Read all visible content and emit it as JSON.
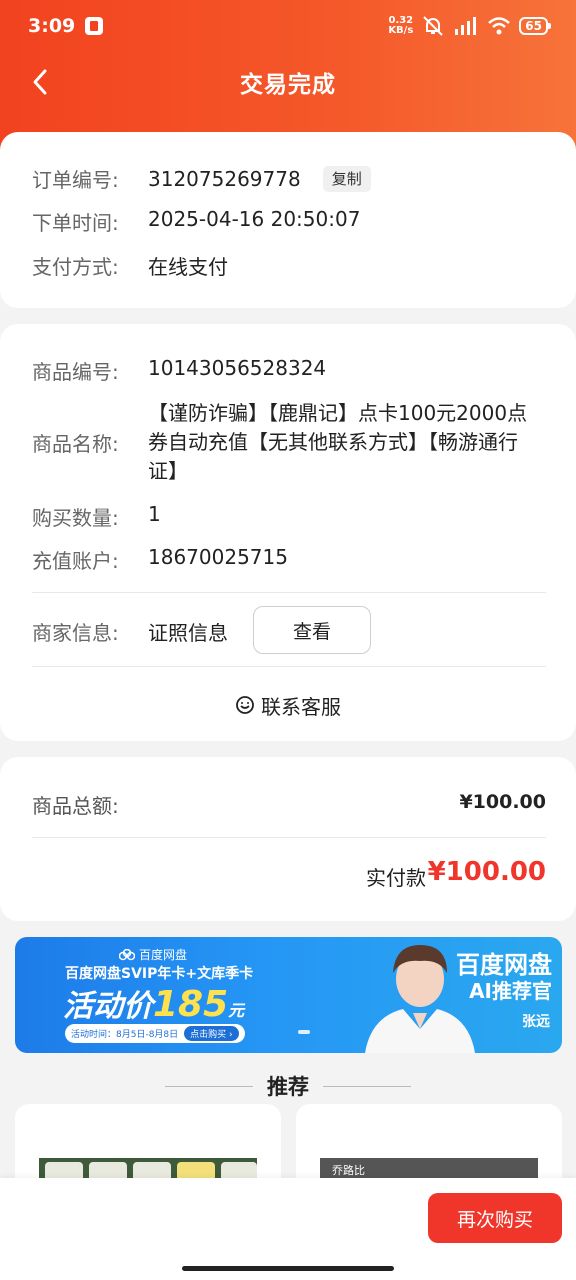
{
  "status_bar": {
    "time": "3:09",
    "net_speed_value": "0.32",
    "net_speed_unit": "KB/s",
    "battery": "65"
  },
  "nav": {
    "title": "交易完成"
  },
  "order": {
    "number_label": "订单编号:",
    "number_value": "312075269778",
    "copy_label": "复制",
    "time_label": "下单时间:",
    "time_value": "2025-04-16 20:50:07",
    "payment_label": "支付方式:",
    "payment_value": "在线支付"
  },
  "product": {
    "id_label": "商品编号:",
    "id_value": "10143056528324",
    "name_label": "商品名称:",
    "name_value": "【谨防诈骗】【鹿鼎记】点卡100元2000点券自动充值【无其他联系方式】【畅游通行证】",
    "quantity_label": "购买数量:",
    "quantity_value": "1",
    "account_label": "充值账户:",
    "account_value": "18670025715",
    "merchant_label": "商家信息:",
    "merchant_value": "证照信息",
    "view_label": "查看",
    "service_label": "联系客服"
  },
  "amounts": {
    "total_label": "商品总额:",
    "total_value": "¥100.00",
    "paid_label": "实付款",
    "paid_value": "¥100.00"
  },
  "banner": {
    "logo_text": "百度网盘",
    "subtitle": "百度网盘SVIP年卡+文库季卡",
    "price_label": "活动价",
    "price_value": "185",
    "price_unit": "元",
    "time_text": "活动时间：8月5日-8月8日",
    "buy_text": "点击购买 ›",
    "brand": "百度网盘",
    "brand_role": "AI推荐官",
    "person_name": "张远"
  },
  "recommend": {
    "title": "推荐",
    "card2_text": "乔路比"
  },
  "bottom": {
    "rebuy_label": "再次购买"
  },
  "colors": {
    "header": "#f2421f",
    "accent": "#f0352b",
    "banner": "#2596f5"
  }
}
